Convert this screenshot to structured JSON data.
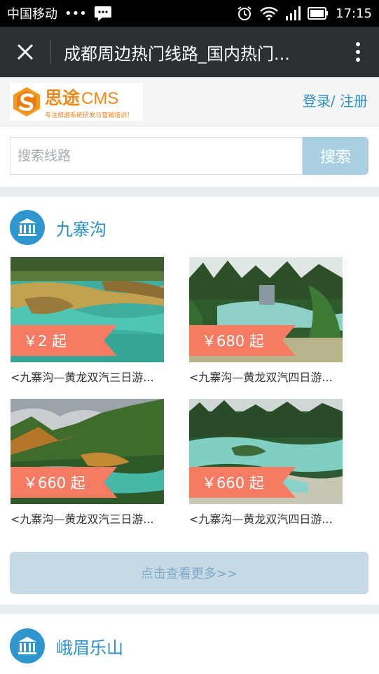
{
  "status_bar": {
    "carrier": "中国移动",
    "dots": "•••",
    "time": "17:15"
  },
  "nav": {
    "title": "成都周边热门线路_国内热门..."
  },
  "header": {
    "logo_cn": "思途",
    "logo_en": "CMS",
    "logo_tagline": "专注旅游系统研发与营销培训！",
    "login_label": "登录/ 注册"
  },
  "search": {
    "placeholder": "搜索线路",
    "button_label": "搜索"
  },
  "sections": [
    {
      "title": "九寨沟",
      "products": [
        {
          "price": "￥2 起",
          "title": "<九寨沟—黄龙双汽三日游..."
        },
        {
          "price": "￥680 起",
          "title": "<九寨沟—黄龙双汽四日游..."
        },
        {
          "price": "￥660 起",
          "title": "<九寨沟—黄龙双汽三日游..."
        },
        {
          "price": "￥660 起",
          "title": "<九寨沟—黄龙双汽四日游..."
        }
      ],
      "more_label": "点击查看更多>>"
    },
    {
      "title": "峨眉乐山"
    }
  ],
  "colors": {
    "accent_blue": "#2f95cf",
    "price_tag": "#f57c63",
    "search_button": "#a9d0e0",
    "nav_bar": "#2c3033"
  }
}
